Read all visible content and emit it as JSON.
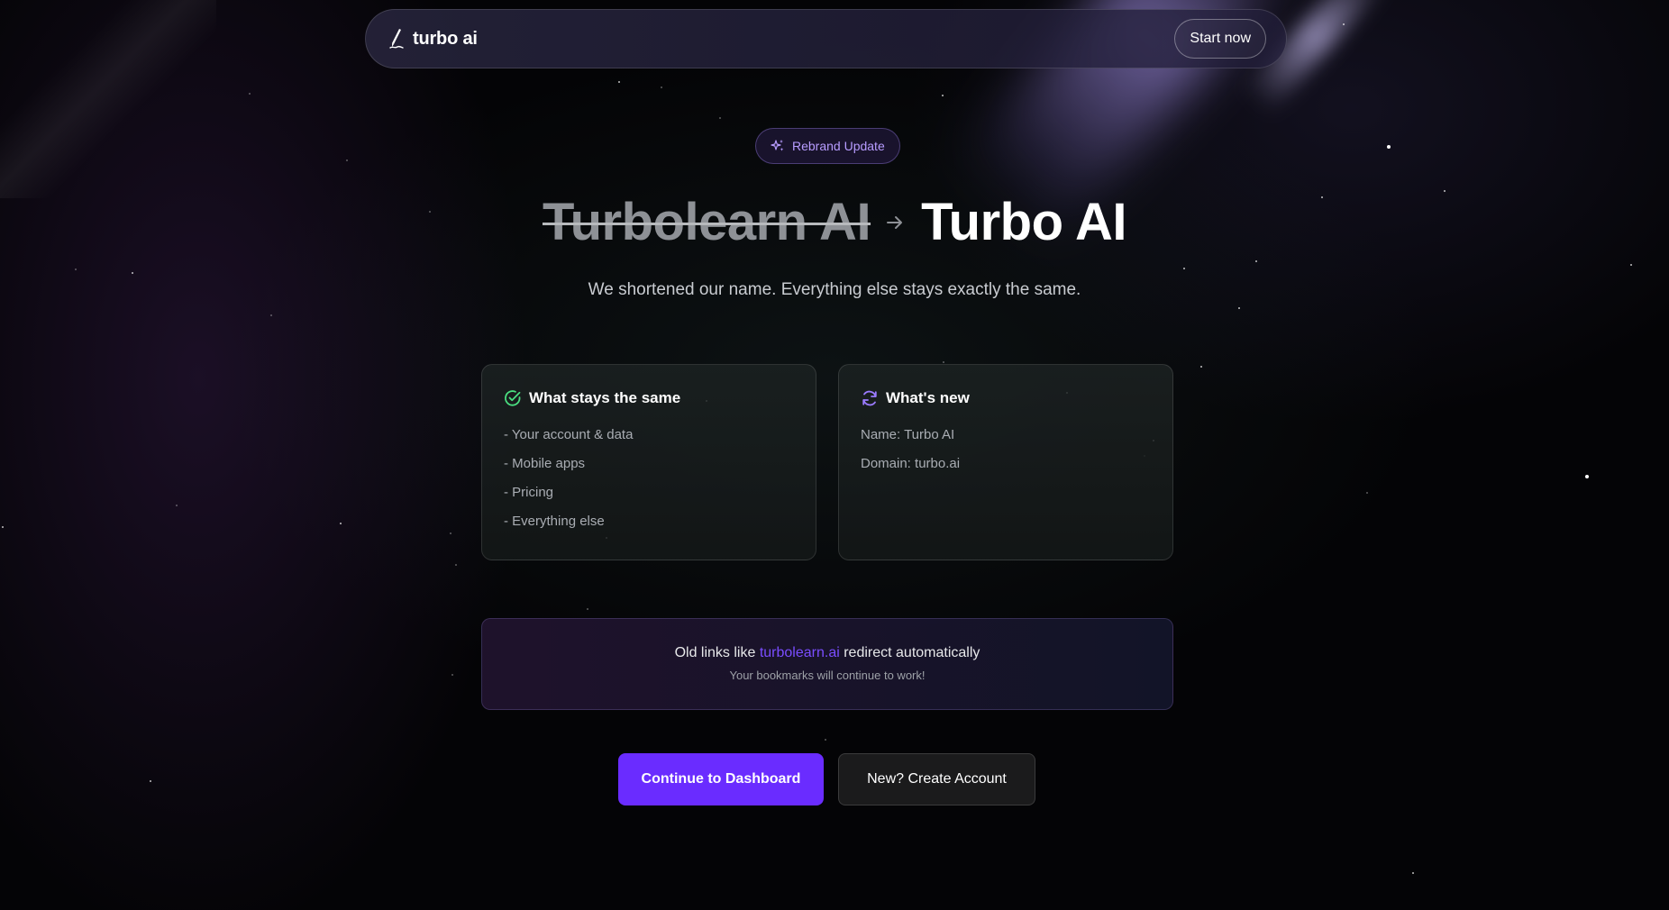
{
  "nav": {
    "brand": "turbo ai",
    "brand_icon": "pen-nib-icon",
    "start_label": "Start now"
  },
  "badge": {
    "icon": "sparkles-icon",
    "label": "Rebrand Update"
  },
  "hero": {
    "old_name": "Turbolearn AI",
    "arrow_icon": "arrow-right-icon",
    "new_name": "Turbo AI",
    "subtitle": "We shortened our name. Everything else stays exactly the same."
  },
  "same_card": {
    "icon": "check-circle-icon",
    "title": "What stays the same",
    "items": [
      "- Your account & data",
      "- Mobile apps",
      "- Pricing",
      "- Everything else"
    ]
  },
  "new_card": {
    "icon": "refresh-icon",
    "title": "What's new",
    "items": [
      "Name: Turbo AI",
      "Domain: turbo.ai"
    ]
  },
  "redirect": {
    "prefix": "Old links like ",
    "link": "turbolearn.ai",
    "suffix": " redirect automatically",
    "sub": "Your bookmarks will continue to work!"
  },
  "actions": {
    "primary_label": "Continue to Dashboard",
    "secondary_label": "New? Create Account"
  },
  "colors": {
    "accent": "#6a2cff",
    "link": "#7a4dff",
    "badge_text": "#b79cff",
    "check_green": "#4ade80",
    "background": "#040406"
  }
}
